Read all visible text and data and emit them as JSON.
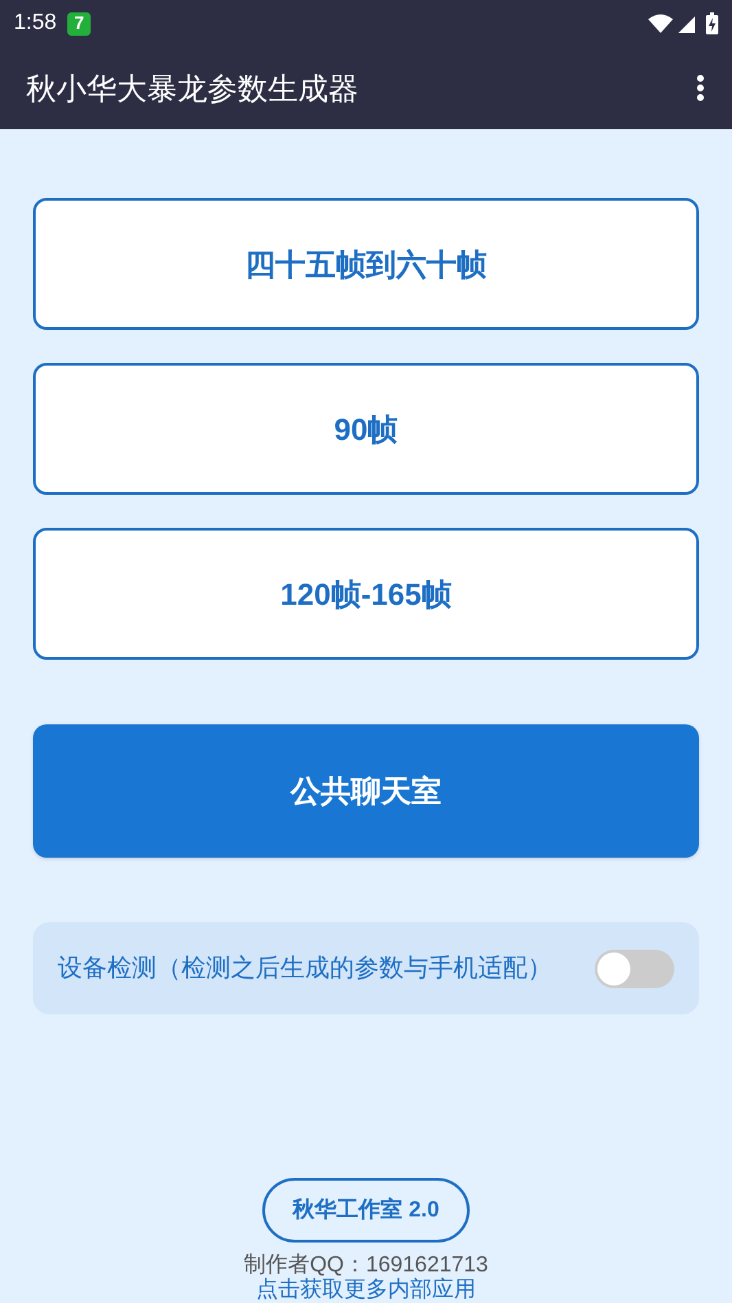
{
  "status_bar": {
    "time": "1:58",
    "app_badge": "7"
  },
  "app_bar": {
    "title": "秋小华大暴龙参数生成器"
  },
  "options": [
    {
      "label": "四十五帧到六十帧"
    },
    {
      "label": "90帧"
    },
    {
      "label": "120帧-165帧"
    }
  ],
  "chat_button": {
    "label": "公共聊天室"
  },
  "device_check": {
    "label": "设备检测（检测之后生成的参数与手机适配）",
    "on": false
  },
  "footer": {
    "studio_button": "秋华工作室 2.0",
    "author": "制作者QQ：1691621713",
    "link": "点击获取更多内部应用"
  }
}
